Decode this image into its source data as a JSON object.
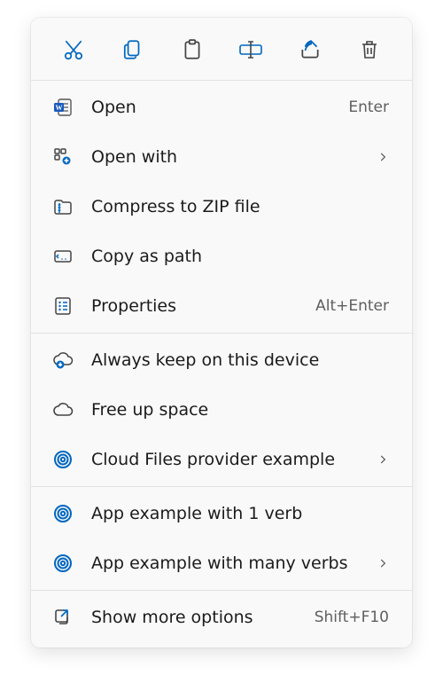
{
  "toolbar": [
    {
      "name": "cut"
    },
    {
      "name": "copy"
    },
    {
      "name": "paste"
    },
    {
      "name": "rename"
    },
    {
      "name": "share"
    },
    {
      "name": "delete"
    }
  ],
  "sections": [
    [
      {
        "key": "open",
        "label": "Open",
        "accel": "Enter",
        "icon": "word-doc"
      },
      {
        "key": "open-with",
        "label": "Open with",
        "submenu": true,
        "icon": "open-with"
      },
      {
        "key": "compress-zip",
        "label": "Compress to ZIP file",
        "icon": "zip"
      },
      {
        "key": "copy-as-path",
        "label": "Copy as path",
        "icon": "path"
      },
      {
        "key": "properties",
        "label": "Properties",
        "accel": "Alt+Enter",
        "icon": "properties"
      }
    ],
    [
      {
        "key": "always-keep",
        "label": "Always keep on this device",
        "icon": "cloud-pin"
      },
      {
        "key": "free-up-space",
        "label": "Free up space",
        "icon": "cloud"
      },
      {
        "key": "cloud-provider",
        "label": "Cloud Files provider example",
        "submenu": true,
        "icon": "spiral"
      }
    ],
    [
      {
        "key": "app-one-verb",
        "label": "App example with 1 verb",
        "icon": "spiral"
      },
      {
        "key": "app-many-verbs",
        "label": "App example with many verbs",
        "submenu": true,
        "icon": "spiral"
      }
    ],
    [
      {
        "key": "show-more",
        "label": "Show more options",
        "accel": "Shift+F10",
        "icon": "expand"
      }
    ]
  ]
}
